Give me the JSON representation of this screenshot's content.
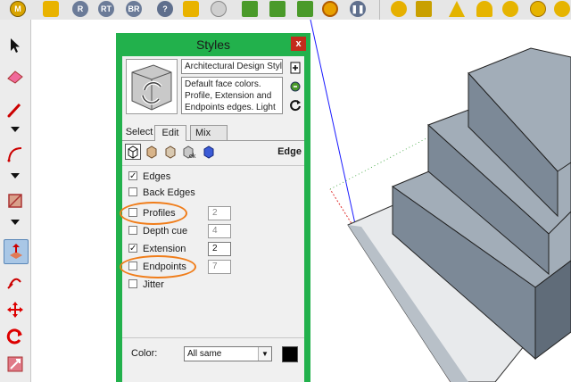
{
  "toolbar": {
    "buttons": [
      {
        "name": "M",
        "color": "#c89a00"
      },
      {
        "name": "R",
        "color": "#5a6b8a"
      },
      {
        "name": "RT",
        "color": "#5a6b8a"
      },
      {
        "name": "BR",
        "color": "#5a6b8a"
      }
    ]
  },
  "styles_panel": {
    "title": "Styles",
    "close_glyph": "x",
    "style_name": "Architectural Design Styl",
    "style_description": "Default face colors. Profile, Extension and Endpoints edges. Light",
    "tabs": [
      {
        "label": "Select",
        "active": false
      },
      {
        "label": "Edit",
        "active": true
      },
      {
        "label": "Mix",
        "active": false
      }
    ],
    "section_label": "Edge",
    "options": [
      {
        "label": "Edges",
        "checked": true,
        "value": null,
        "highlighted": false
      },
      {
        "label": "Back Edges",
        "checked": false,
        "value": null,
        "highlighted": false
      },
      {
        "label": "Profiles",
        "checked": false,
        "value": "2",
        "highlighted": true
      },
      {
        "label": "Depth cue",
        "checked": false,
        "value": "4",
        "highlighted": false
      },
      {
        "label": "Extension",
        "checked": true,
        "value": "2",
        "highlighted": false
      },
      {
        "label": "Endpoints",
        "checked": false,
        "value": "7",
        "highlighted": true
      },
      {
        "label": "Jitter",
        "checked": false,
        "value": null,
        "highlighted": false
      }
    ],
    "color_label": "Color:",
    "color_value": "All same",
    "color_swatch": "#000000"
  },
  "colors": {
    "panel_frame": "#22b14c",
    "annotation": "#f07d1a",
    "model_top": "#9aa7b4",
    "model_side": "#6f7c89"
  }
}
